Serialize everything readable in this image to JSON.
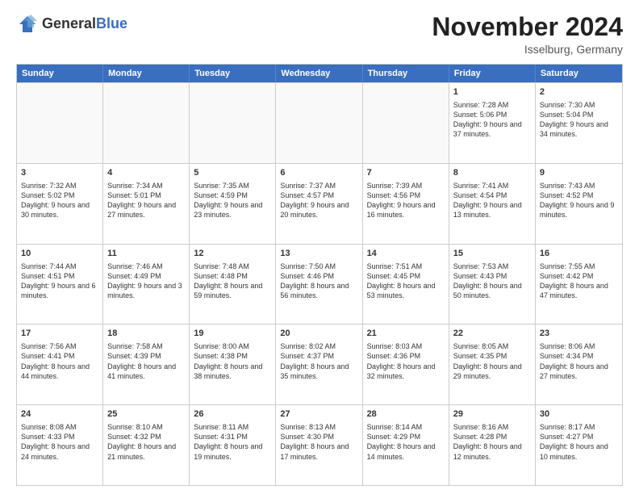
{
  "logo": {
    "general": "General",
    "blue": "Blue"
  },
  "header": {
    "month": "November 2024",
    "location": "Isselburg, Germany"
  },
  "days": [
    "Sunday",
    "Monday",
    "Tuesday",
    "Wednesday",
    "Thursday",
    "Friday",
    "Saturday"
  ],
  "rows": [
    [
      {
        "day": "",
        "content": "",
        "empty": true
      },
      {
        "day": "",
        "content": "",
        "empty": true
      },
      {
        "day": "",
        "content": "",
        "empty": true
      },
      {
        "day": "",
        "content": "",
        "empty": true
      },
      {
        "day": "",
        "content": "",
        "empty": true
      },
      {
        "day": "1",
        "content": "Sunrise: 7:28 AM\nSunset: 5:06 PM\nDaylight: 9 hours and 37 minutes.",
        "empty": false
      },
      {
        "day": "2",
        "content": "Sunrise: 7:30 AM\nSunset: 5:04 PM\nDaylight: 9 hours and 34 minutes.",
        "empty": false
      }
    ],
    [
      {
        "day": "3",
        "content": "Sunrise: 7:32 AM\nSunset: 5:02 PM\nDaylight: 9 hours and 30 minutes.",
        "empty": false
      },
      {
        "day": "4",
        "content": "Sunrise: 7:34 AM\nSunset: 5:01 PM\nDaylight: 9 hours and 27 minutes.",
        "empty": false
      },
      {
        "day": "5",
        "content": "Sunrise: 7:35 AM\nSunset: 4:59 PM\nDaylight: 9 hours and 23 minutes.",
        "empty": false
      },
      {
        "day": "6",
        "content": "Sunrise: 7:37 AM\nSunset: 4:57 PM\nDaylight: 9 hours and 20 minutes.",
        "empty": false
      },
      {
        "day": "7",
        "content": "Sunrise: 7:39 AM\nSunset: 4:56 PM\nDaylight: 9 hours and 16 minutes.",
        "empty": false
      },
      {
        "day": "8",
        "content": "Sunrise: 7:41 AM\nSunset: 4:54 PM\nDaylight: 9 hours and 13 minutes.",
        "empty": false
      },
      {
        "day": "9",
        "content": "Sunrise: 7:43 AM\nSunset: 4:52 PM\nDaylight: 9 hours and 9 minutes.",
        "empty": false
      }
    ],
    [
      {
        "day": "10",
        "content": "Sunrise: 7:44 AM\nSunset: 4:51 PM\nDaylight: 9 hours and 6 minutes.",
        "empty": false
      },
      {
        "day": "11",
        "content": "Sunrise: 7:46 AM\nSunset: 4:49 PM\nDaylight: 9 hours and 3 minutes.",
        "empty": false
      },
      {
        "day": "12",
        "content": "Sunrise: 7:48 AM\nSunset: 4:48 PM\nDaylight: 8 hours and 59 minutes.",
        "empty": false
      },
      {
        "day": "13",
        "content": "Sunrise: 7:50 AM\nSunset: 4:46 PM\nDaylight: 8 hours and 56 minutes.",
        "empty": false
      },
      {
        "day": "14",
        "content": "Sunrise: 7:51 AM\nSunset: 4:45 PM\nDaylight: 8 hours and 53 minutes.",
        "empty": false
      },
      {
        "day": "15",
        "content": "Sunrise: 7:53 AM\nSunset: 4:43 PM\nDaylight: 8 hours and 50 minutes.",
        "empty": false
      },
      {
        "day": "16",
        "content": "Sunrise: 7:55 AM\nSunset: 4:42 PM\nDaylight: 8 hours and 47 minutes.",
        "empty": false
      }
    ],
    [
      {
        "day": "17",
        "content": "Sunrise: 7:56 AM\nSunset: 4:41 PM\nDaylight: 8 hours and 44 minutes.",
        "empty": false
      },
      {
        "day": "18",
        "content": "Sunrise: 7:58 AM\nSunset: 4:39 PM\nDaylight: 8 hours and 41 minutes.",
        "empty": false
      },
      {
        "day": "19",
        "content": "Sunrise: 8:00 AM\nSunset: 4:38 PM\nDaylight: 8 hours and 38 minutes.",
        "empty": false
      },
      {
        "day": "20",
        "content": "Sunrise: 8:02 AM\nSunset: 4:37 PM\nDaylight: 8 hours and 35 minutes.",
        "empty": false
      },
      {
        "day": "21",
        "content": "Sunrise: 8:03 AM\nSunset: 4:36 PM\nDaylight: 8 hours and 32 minutes.",
        "empty": false
      },
      {
        "day": "22",
        "content": "Sunrise: 8:05 AM\nSunset: 4:35 PM\nDaylight: 8 hours and 29 minutes.",
        "empty": false
      },
      {
        "day": "23",
        "content": "Sunrise: 8:06 AM\nSunset: 4:34 PM\nDaylight: 8 hours and 27 minutes.",
        "empty": false
      }
    ],
    [
      {
        "day": "24",
        "content": "Sunrise: 8:08 AM\nSunset: 4:33 PM\nDaylight: 8 hours and 24 minutes.",
        "empty": false
      },
      {
        "day": "25",
        "content": "Sunrise: 8:10 AM\nSunset: 4:32 PM\nDaylight: 8 hours and 21 minutes.",
        "empty": false
      },
      {
        "day": "26",
        "content": "Sunrise: 8:11 AM\nSunset: 4:31 PM\nDaylight: 8 hours and 19 minutes.",
        "empty": false
      },
      {
        "day": "27",
        "content": "Sunrise: 8:13 AM\nSunset: 4:30 PM\nDaylight: 8 hours and 17 minutes.",
        "empty": false
      },
      {
        "day": "28",
        "content": "Sunrise: 8:14 AM\nSunset: 4:29 PM\nDaylight: 8 hours and 14 minutes.",
        "empty": false
      },
      {
        "day": "29",
        "content": "Sunrise: 8:16 AM\nSunset: 4:28 PM\nDaylight: 8 hours and 12 minutes.",
        "empty": false
      },
      {
        "day": "30",
        "content": "Sunrise: 8:17 AM\nSunset: 4:27 PM\nDaylight: 8 hours and 10 minutes.",
        "empty": false
      }
    ]
  ]
}
